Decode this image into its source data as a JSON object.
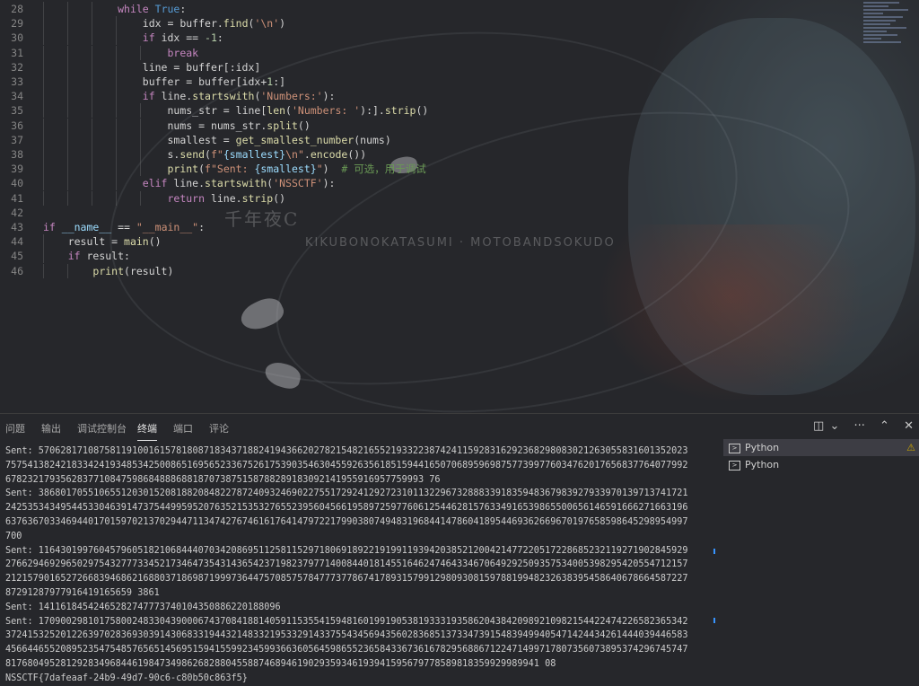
{
  "editor": {
    "lines": [
      {
        "num": "28",
        "indent": 3,
        "tokens": [
          {
            "t": "while ",
            "c": "kw2"
          },
          {
            "t": "True",
            "c": "kw"
          },
          {
            "t": ":",
            "c": ""
          }
        ]
      },
      {
        "num": "29",
        "indent": 4,
        "tokens": [
          {
            "t": "idx = buffer.",
            "c": ""
          },
          {
            "t": "find",
            "c": "fn"
          },
          {
            "t": "(",
            "c": ""
          },
          {
            "t": "'\\n'",
            "c": "str"
          },
          {
            "t": ")",
            "c": ""
          }
        ]
      },
      {
        "num": "30",
        "indent": 4,
        "tokens": [
          {
            "t": "if ",
            "c": "kw2"
          },
          {
            "t": "idx == ",
            "c": ""
          },
          {
            "t": "-1",
            "c": "num"
          },
          {
            "t": ":",
            "c": ""
          }
        ]
      },
      {
        "num": "31",
        "indent": 5,
        "tokens": [
          {
            "t": "break",
            "c": "kw2"
          }
        ]
      },
      {
        "num": "32",
        "indent": 4,
        "tokens": [
          {
            "t": "line = buffer[:idx]",
            "c": ""
          }
        ]
      },
      {
        "num": "33",
        "indent": 4,
        "tokens": [
          {
            "t": "buffer = buffer[idx+",
            "c": ""
          },
          {
            "t": "1",
            "c": "num"
          },
          {
            "t": ":]",
            "c": ""
          }
        ]
      },
      {
        "num": "34",
        "indent": 4,
        "tokens": [
          {
            "t": "if ",
            "c": "kw2"
          },
          {
            "t": "line.",
            "c": ""
          },
          {
            "t": "startswith",
            "c": "fn"
          },
          {
            "t": "(",
            "c": ""
          },
          {
            "t": "'Numbers:'",
            "c": "str"
          },
          {
            "t": "):",
            "c": ""
          }
        ]
      },
      {
        "num": "35",
        "indent": 5,
        "tokens": [
          {
            "t": "nums_str = line[",
            "c": ""
          },
          {
            "t": "len",
            "c": "fn"
          },
          {
            "t": "(",
            "c": ""
          },
          {
            "t": "'Numbers: '",
            "c": "str"
          },
          {
            "t": "):].",
            "c": ""
          },
          {
            "t": "strip",
            "c": "fn"
          },
          {
            "t": "()",
            "c": ""
          }
        ]
      },
      {
        "num": "36",
        "indent": 5,
        "tokens": [
          {
            "t": "nums = nums_str.",
            "c": ""
          },
          {
            "t": "split",
            "c": "fn"
          },
          {
            "t": "()",
            "c": ""
          }
        ]
      },
      {
        "num": "37",
        "indent": 5,
        "tokens": [
          {
            "t": "smallest = ",
            "c": ""
          },
          {
            "t": "get_smallest_number",
            "c": "fn"
          },
          {
            "t": "(nums)",
            "c": ""
          }
        ]
      },
      {
        "num": "38",
        "indent": 5,
        "tokens": [
          {
            "t": "s.",
            "c": ""
          },
          {
            "t": "send",
            "c": "fn"
          },
          {
            "t": "(",
            "c": ""
          },
          {
            "t": "f\"",
            "c": "str"
          },
          {
            "t": "{smallest}",
            "c": "var"
          },
          {
            "t": "\\n\"",
            "c": "str"
          },
          {
            "t": ".",
            "c": ""
          },
          {
            "t": "encode",
            "c": "fn"
          },
          {
            "t": "())",
            "c": ""
          }
        ]
      },
      {
        "num": "39",
        "indent": 5,
        "tokens": [
          {
            "t": "print",
            "c": "fn"
          },
          {
            "t": "(",
            "c": ""
          },
          {
            "t": "f\"Sent: ",
            "c": "str"
          },
          {
            "t": "{smallest}",
            "c": "var"
          },
          {
            "t": "\"",
            "c": "str"
          },
          {
            "t": ")  ",
            "c": ""
          },
          {
            "t": "# 可选，用于调试",
            "c": "cmt"
          }
        ]
      },
      {
        "num": "40",
        "indent": 4,
        "tokens": [
          {
            "t": "elif ",
            "c": "kw2"
          },
          {
            "t": "line.",
            "c": ""
          },
          {
            "t": "startswith",
            "c": "fn"
          },
          {
            "t": "(",
            "c": ""
          },
          {
            "t": "'NSSCTF'",
            "c": "str"
          },
          {
            "t": "):",
            "c": ""
          }
        ]
      },
      {
        "num": "41",
        "indent": 5,
        "tokens": [
          {
            "t": "return ",
            "c": "kw2"
          },
          {
            "t": "line.",
            "c": ""
          },
          {
            "t": "strip",
            "c": "fn"
          },
          {
            "t": "()",
            "c": ""
          }
        ]
      },
      {
        "num": "42",
        "indent": 0,
        "tokens": []
      },
      {
        "num": "43",
        "indent": 0,
        "tokens": [
          {
            "t": "if ",
            "c": "kw2"
          },
          {
            "t": "__name__",
            "c": "var"
          },
          {
            "t": " == ",
            "c": ""
          },
          {
            "t": "\"__main__\"",
            "c": "str"
          },
          {
            "t": ":",
            "c": ""
          }
        ]
      },
      {
        "num": "44",
        "indent": 1,
        "tokens": [
          {
            "t": "result = ",
            "c": ""
          },
          {
            "t": "main",
            "c": "fn"
          },
          {
            "t": "()",
            "c": ""
          }
        ]
      },
      {
        "num": "45",
        "indent": 1,
        "tokens": [
          {
            "t": "if ",
            "c": "kw2"
          },
          {
            "t": "result:",
            "c": ""
          }
        ]
      },
      {
        "num": "46",
        "indent": 2,
        "tokens": [
          {
            "t": "print",
            "c": "fn"
          },
          {
            "t": "(result)",
            "c": ""
          }
        ]
      }
    ]
  },
  "wallpaper": {
    "text1": "千年夜C",
    "text2": "KIKUBONOKATASUMI · MOTOBANDSOKUDO"
  },
  "panel": {
    "tabs": [
      {
        "label": "问题",
        "active": false
      },
      {
        "label": "输出",
        "active": false
      },
      {
        "label": "调试控制台",
        "active": false
      },
      {
        "label": "终端",
        "active": true
      },
      {
        "label": "端口",
        "active": false
      },
      {
        "label": "评论",
        "active": false
      }
    ],
    "actions": {
      "layout": "◫",
      "dropdown": "⌄",
      "more": "···",
      "collapse": "⌃",
      "close": "✕"
    },
    "terminal_lines": [
      "Sent: 5706281710875811910016157818087183437188241943662027821548216552193322387424115928316292368298083021263055831601352023",
      "7575413824218334241934853425008651695652336752617539035463045592635618515944165070689596987577399776034762017656837764077992",
      "6782321793562837710847598684888688187073875158788289183092141955916957759993 76",
      "Sent: 3868017055106551203015208188208482278724093246902275517292412927231011322967328883391835948367983927933970139713741721",
      "2425353434954453304639147375449959520763521535327655239560456619589725977606125446281576334916539865500656146591666271663196",
      "6376367033469440170159702137029447113474276746161764147972217990380749483196844147860418954469362669670197658598645298954997",
      "700",
      "Sent: 1164301997604579605182106844407034208695112581152971806918922191991193942038521200421477220517228685232119271902845929",
      "2766294692965029754327773345217346473543143654237198237977140084401814551646247464334670649292509357534005398295420554712157",
      "2121579016527266839468621688037186987199973644757085757847773778674178931579912980930815978819948232638395458640678664587227",
      "87291287977916419165659 3861",
      "Sent: 14116184542465282747773740104350886220188096",
      "Sent: 1709002981017580024833043900067437084188140591153554159481601991905381933319358620438420989210982154422474226582365342",
      "3724153252012263970283693039143068331944321483321953329143375543456943560283685137334739154839499405471424434261444039446583",
      "4566446552089523547548576565145695159415599234599366360564598655236584336736167829568867122471499717807356073895374296745747",
      "8176804952812928349684461984734986268288045588746894619029359346193941595679778589818359929989941 08",
      "NSSCTF{7dafeaaf-24b9-49d7-90c6-c80b50c863f5}"
    ],
    "sessions": [
      {
        "label": "Python",
        "active": true,
        "warn": "⚠"
      },
      {
        "label": "Python",
        "active": false,
        "warn": ""
      }
    ]
  }
}
